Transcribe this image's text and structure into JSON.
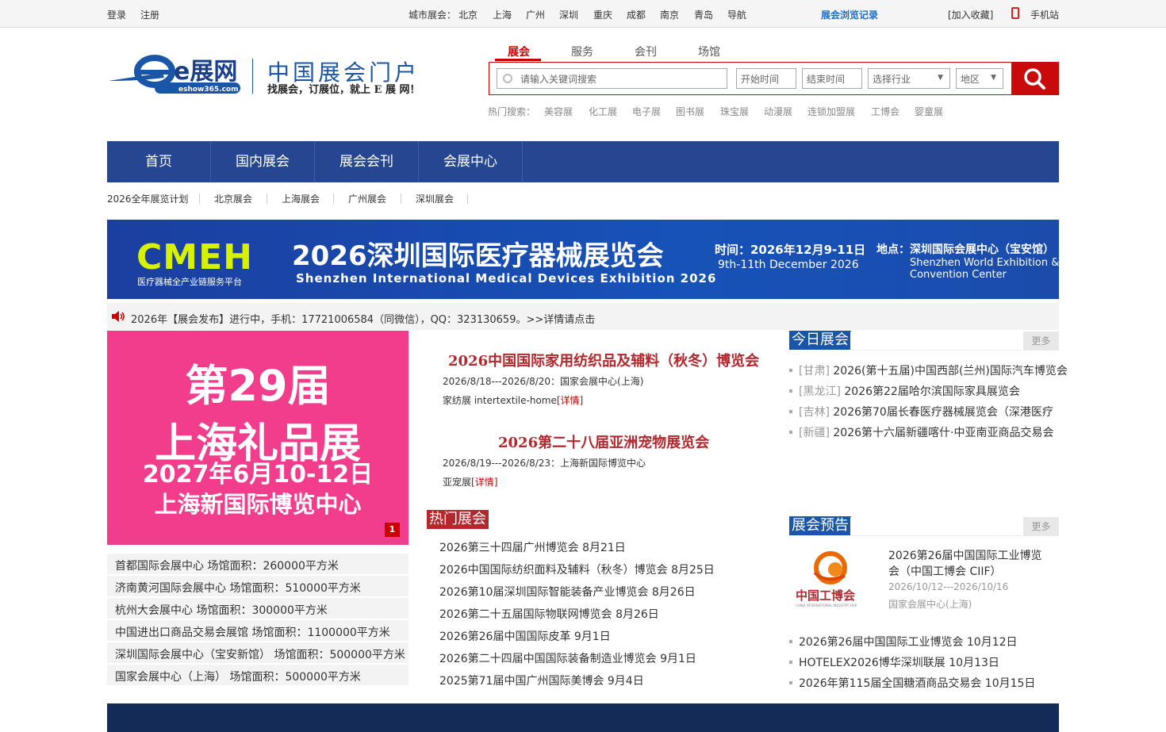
{
  "topbar": {
    "login": "登录",
    "register": "注册",
    "city_label": "城市展会：",
    "cities": [
      "北京",
      "上海",
      "广州",
      "深圳",
      "重庆",
      "成都",
      "南京",
      "青岛",
      "导航"
    ],
    "history": "展会浏览记录",
    "favorite": "[加入收藏]",
    "mobile": "手机站"
  },
  "logo": {
    "mark": "e展网",
    "domain": "eshow365.com",
    "title": "中国展会门户",
    "slogan": "找展会，订展位，就上 E 展 网！"
  },
  "search": {
    "tabs": [
      "展会",
      "服务",
      "会刊",
      "场馆"
    ],
    "placeholder": "请输入关键词搜索",
    "start": "开始时间",
    "end": "结束时间",
    "industry": "选择行业",
    "region": "地区",
    "hot_label": "热门搜索：",
    "hot": [
      "美容展",
      "化工展",
      "电子展",
      "图书展",
      "珠宝展",
      "动漫展",
      "连锁加盟展",
      "工博会",
      "婴童展"
    ]
  },
  "nav": {
    "items": [
      "首页",
      "国内展会",
      "展会会刊",
      "会展中心"
    ],
    "sub": [
      "2026全年展览计划",
      "北京展会",
      "上海展会",
      "广州展会",
      "深圳展会"
    ]
  },
  "banner": {
    "logo": "CMEH",
    "logo_sub": "医疗器械全产业链服务平台",
    "title": "2026深圳国际医疗器械展览会",
    "en": "Shenzhen International Medical Devices Exhibition  2026",
    "time": "时间：2026年12月9-11日",
    "time_en": "9th-11th December 2026",
    "loc": "地点：深圳国际会展中心（宝安馆）",
    "loc_en1": "Shenzhen World Exhibition &",
    "loc_en2": "Convention Center"
  },
  "notice": "2026年【展会发布】进行中，手机：17721006584（同微信），QQ：323130659。>>详情请点击",
  "slide": {
    "l1": "第29届",
    "l2": "上海礼品展",
    "l3": "2027年6月10-12日",
    "l4": "上海新国际博览中心",
    "page": "1"
  },
  "venues": [
    "首都国际会展中心 场馆面积：260000平方米",
    "济南黄河国际会展中心 场馆面积：510000平方米",
    "杭州大会展中心 场馆面积：300000平方米",
    "中国进出口商品交易会展馆 场馆面积：1100000平方米",
    "深圳国际会展中心（宝安新馆） 场馆面积：500000平方米",
    "国家会展中心（上海） 场馆面积：500000平方米"
  ],
  "featured": [
    {
      "title": "2026中国国际家用纺织品及辅料（秋冬）博览会",
      "date": "2026/8/18---2026/8/20：国家会展中心(上海)",
      "cat": "家纺展 intertextile-home",
      "detail": "[详情]"
    },
    {
      "title": "2026第二十八届亚洲宠物展览会",
      "date": "2026/8/19---2026/8/23：上海新国际博览中心",
      "cat": "亚宠展",
      "detail": "[详情]"
    }
  ],
  "hot_expo": {
    "title": "热门展会",
    "items": [
      "2026第三十四届广州博览会 8月21日",
      "2026中国国际纺织面料及辅料（秋冬）博览会 8月25日",
      "2026第10届深圳国际智能装备产业博览会 8月26日",
      "2026第二十五届国际物联网博览会 8月26日",
      "2026第26届中国国际皮革 9月1日",
      "2026第二十四届中国国际装备制造业博览会 9月1日",
      "2025第71届中国广州国际美博会 9月4日"
    ]
  },
  "today": {
    "title": "今日展会",
    "more": "更多",
    "items": [
      {
        "prov": "[甘肃]",
        "name": "2026(第十五届)中国西部(兰州)国际汽车博览会"
      },
      {
        "prov": "[黑龙江]",
        "name": "2026第22届哈尔滨国际家具展览会"
      },
      {
        "prov": "[吉林]",
        "name": "2026第70届长春医疗器械展览会（深港医疗"
      },
      {
        "prov": "[新疆]",
        "name": "2026第十六届新疆喀什·中亚南亚商品交易会"
      }
    ]
  },
  "preview": {
    "title": "展会预告",
    "more": "更多",
    "ciif_logo": "中国工博会",
    "ciif_logo_en": "CHINA INTERNATIONAL INDUSTRY FAIR",
    "feature_title": "2026第26届中国国际工业博览会（中国工博会 CIIF）",
    "feature_date": "2026/10/12---2026/10/16",
    "feature_place": "国家会展中心(上海)",
    "items": [
      "2026第26届中国国际工业博览会 10月12日",
      "HOTELEX2026博华深圳联展 10月13日",
      "2026年第115届全国糖酒商品交易会 10月15日"
    ]
  },
  "colors": {
    "brand_blue": "#254691",
    "accent_red": "#b3272d",
    "pink": "#f23d8c"
  }
}
